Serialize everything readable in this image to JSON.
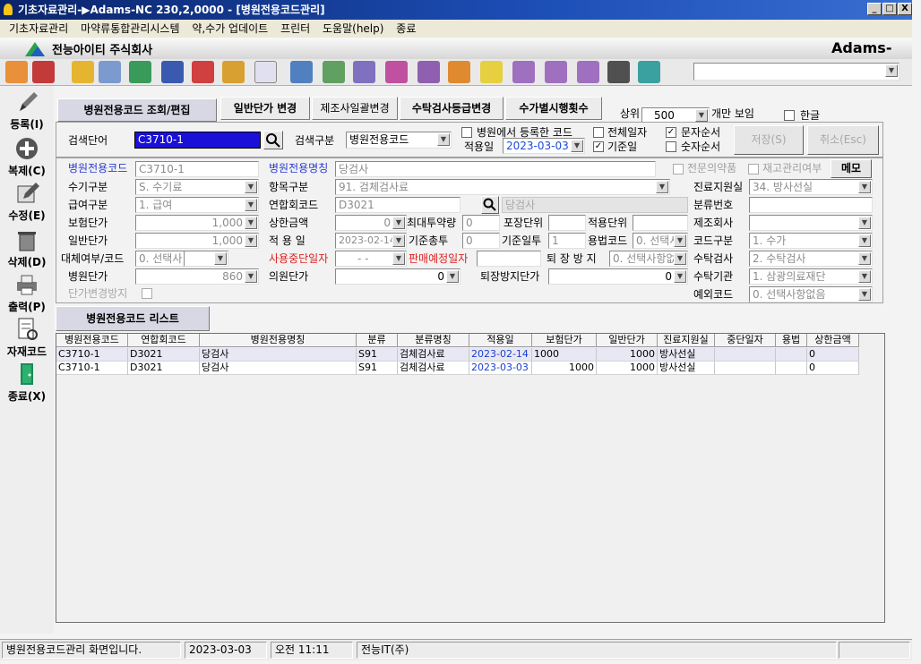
{
  "window": {
    "title": "기초자료관리-▶Adams-NC 230,2,0000 - [병원전용코드관리]",
    "minimize": "_",
    "restore": "□",
    "close": "X"
  },
  "menu": [
    "기초자료관리",
    "마약류통합관리시스템",
    "약,수가 업데이트",
    "프린터",
    "도움말(help)",
    "종료"
  ],
  "brand": {
    "company": "전능아이티 주식회사",
    "product": "Adams-NC"
  },
  "toolbar": {
    "combo_value": ""
  },
  "sidebar": [
    {
      "label": "등록(I)",
      "icon": "pencil-icon"
    },
    {
      "label": "복제(C)",
      "icon": "plus-icon"
    },
    {
      "label": "수정(E)",
      "icon": "edit-icon"
    },
    {
      "label": "삭제(D)",
      "icon": "trash-icon"
    },
    {
      "label": "출력(P)",
      "icon": "printer-icon"
    },
    {
      "label": "자재코드",
      "icon": "document-icon"
    },
    {
      "label": "종료(X)",
      "icon": "exit-door-icon"
    }
  ],
  "tabs": [
    "병원전용코드 조회/편집",
    "일반단가 변경",
    "제조사일괄변경",
    "수탁검사등급변경",
    "수가별시행횟수"
  ],
  "top": {
    "limit_label": "상위",
    "limit_value": "500",
    "limit_suffix": "개만 보임",
    "hangul_label": "한글"
  },
  "search": {
    "term_label": "검색단어",
    "term_value": "C3710-1",
    "type_label": "검색구분",
    "type_value": "병원전용코드",
    "registered_label": "병원에서 등록한 코드",
    "apply_date_label": "적용일",
    "apply_date_value": "2023-03-03",
    "all_date_label": "전체일자",
    "base_date_label": "기준일",
    "text_order_label": "문자순서",
    "num_order_label": "숫자순서",
    "save_button": "저장(S)",
    "cancel_button": "취소(Esc)"
  },
  "form": {
    "hosp_code_label": "병원전용코드",
    "hosp_code": "C3710-1",
    "hosp_name_label": "병원전용명칭",
    "hosp_name": "당검사",
    "specialist_label": "전문의약품",
    "inventory_label": "재고관리여부",
    "memo_button": "메모",
    "fee_type_label": "수기구분",
    "fee_type": "S. 수기료",
    "item_type_label": "항목구분",
    "item_type": "91. 검체검사료",
    "dept_label": "진료지원실",
    "dept": "34. 방사선실",
    "pay_type_label": "급여구분",
    "pay_type": "1. 급여",
    "assoc_code_label": "연합회코드",
    "assoc_code": "D3021",
    "assoc_name": "당검사",
    "class_no_label": "분류번호",
    "class_no": "",
    "insurance_price_label": "보험단가",
    "insurance_price": "1,000",
    "max_amount_label": "상한금액",
    "max_amount": "0",
    "max_dose_label": "최대투약량",
    "max_dose": "0",
    "pack_unit_label": "포장단위",
    "pack_unit": "",
    "apply_unit_label": "적용단위",
    "apply_unit": "",
    "maker_label": "제조회사",
    "maker": "",
    "general_price_label": "일반단가",
    "general_price": "1,000",
    "apply_date_label": "적 용 일",
    "apply_date": "2023-02-14",
    "base_total_label": "기준총투",
    "base_total": "0",
    "base_days_label": "기준일투",
    "base_days": "1",
    "usage_code_label": "용법코드",
    "usage_code": "0. 선택사",
    "code_type_label": "코드구분",
    "code_type": "1. 수가",
    "substitute_label": "대체여부/코드",
    "substitute": "0. 선택사",
    "stop_date_label": "사용중단일자",
    "stop_date": "- -",
    "sale_date_label": "판매예정일자",
    "sale_date": "",
    "discharge_label": "퇴 장 방 지",
    "discharge": "0. 선택사항없",
    "outsource_label": "수탁검사",
    "outsource": "2. 수탁검사",
    "hosp_price_label": "병원단가",
    "hosp_price": "860",
    "clinic_price_label": "의원단가",
    "clinic_price": "0",
    "discharge_price_label": "퇴장방지단가",
    "discharge_price": "0",
    "outsource_org_label": "수탁기관",
    "outsource_org": "1. 삼광의료재단",
    "price_change_label": "단가변경방지",
    "exception_label": "예외코드",
    "exception": "0. 선택사항없음"
  },
  "list": {
    "title": "병원전용코드 리스트",
    "headers": [
      "병원전용코드",
      "연합회코드",
      "병원전용명칭",
      "분류",
      "분류명칭",
      "적용일",
      "보험단가",
      "일반단가",
      "진료지원실",
      "중단일자",
      "용법",
      "상한금액"
    ],
    "rows": [
      [
        "C3710-1",
        "D3021",
        "당검사",
        "S91",
        "검체검사료",
        "2023-02-14",
        "1000",
        "1000",
        "방사선실",
        "",
        "",
        "0"
      ],
      [
        "C3710-1",
        "D3021",
        "당검사",
        "S91",
        "검체검사료",
        "2023-03-03",
        "1000",
        "1000",
        "방사선실",
        "",
        "",
        "0"
      ]
    ]
  },
  "status": {
    "message": "병원전용코드관리 화면입니다.",
    "date": "2023-03-03",
    "time": "오전 11:11",
    "company": "전능IT(주)"
  }
}
